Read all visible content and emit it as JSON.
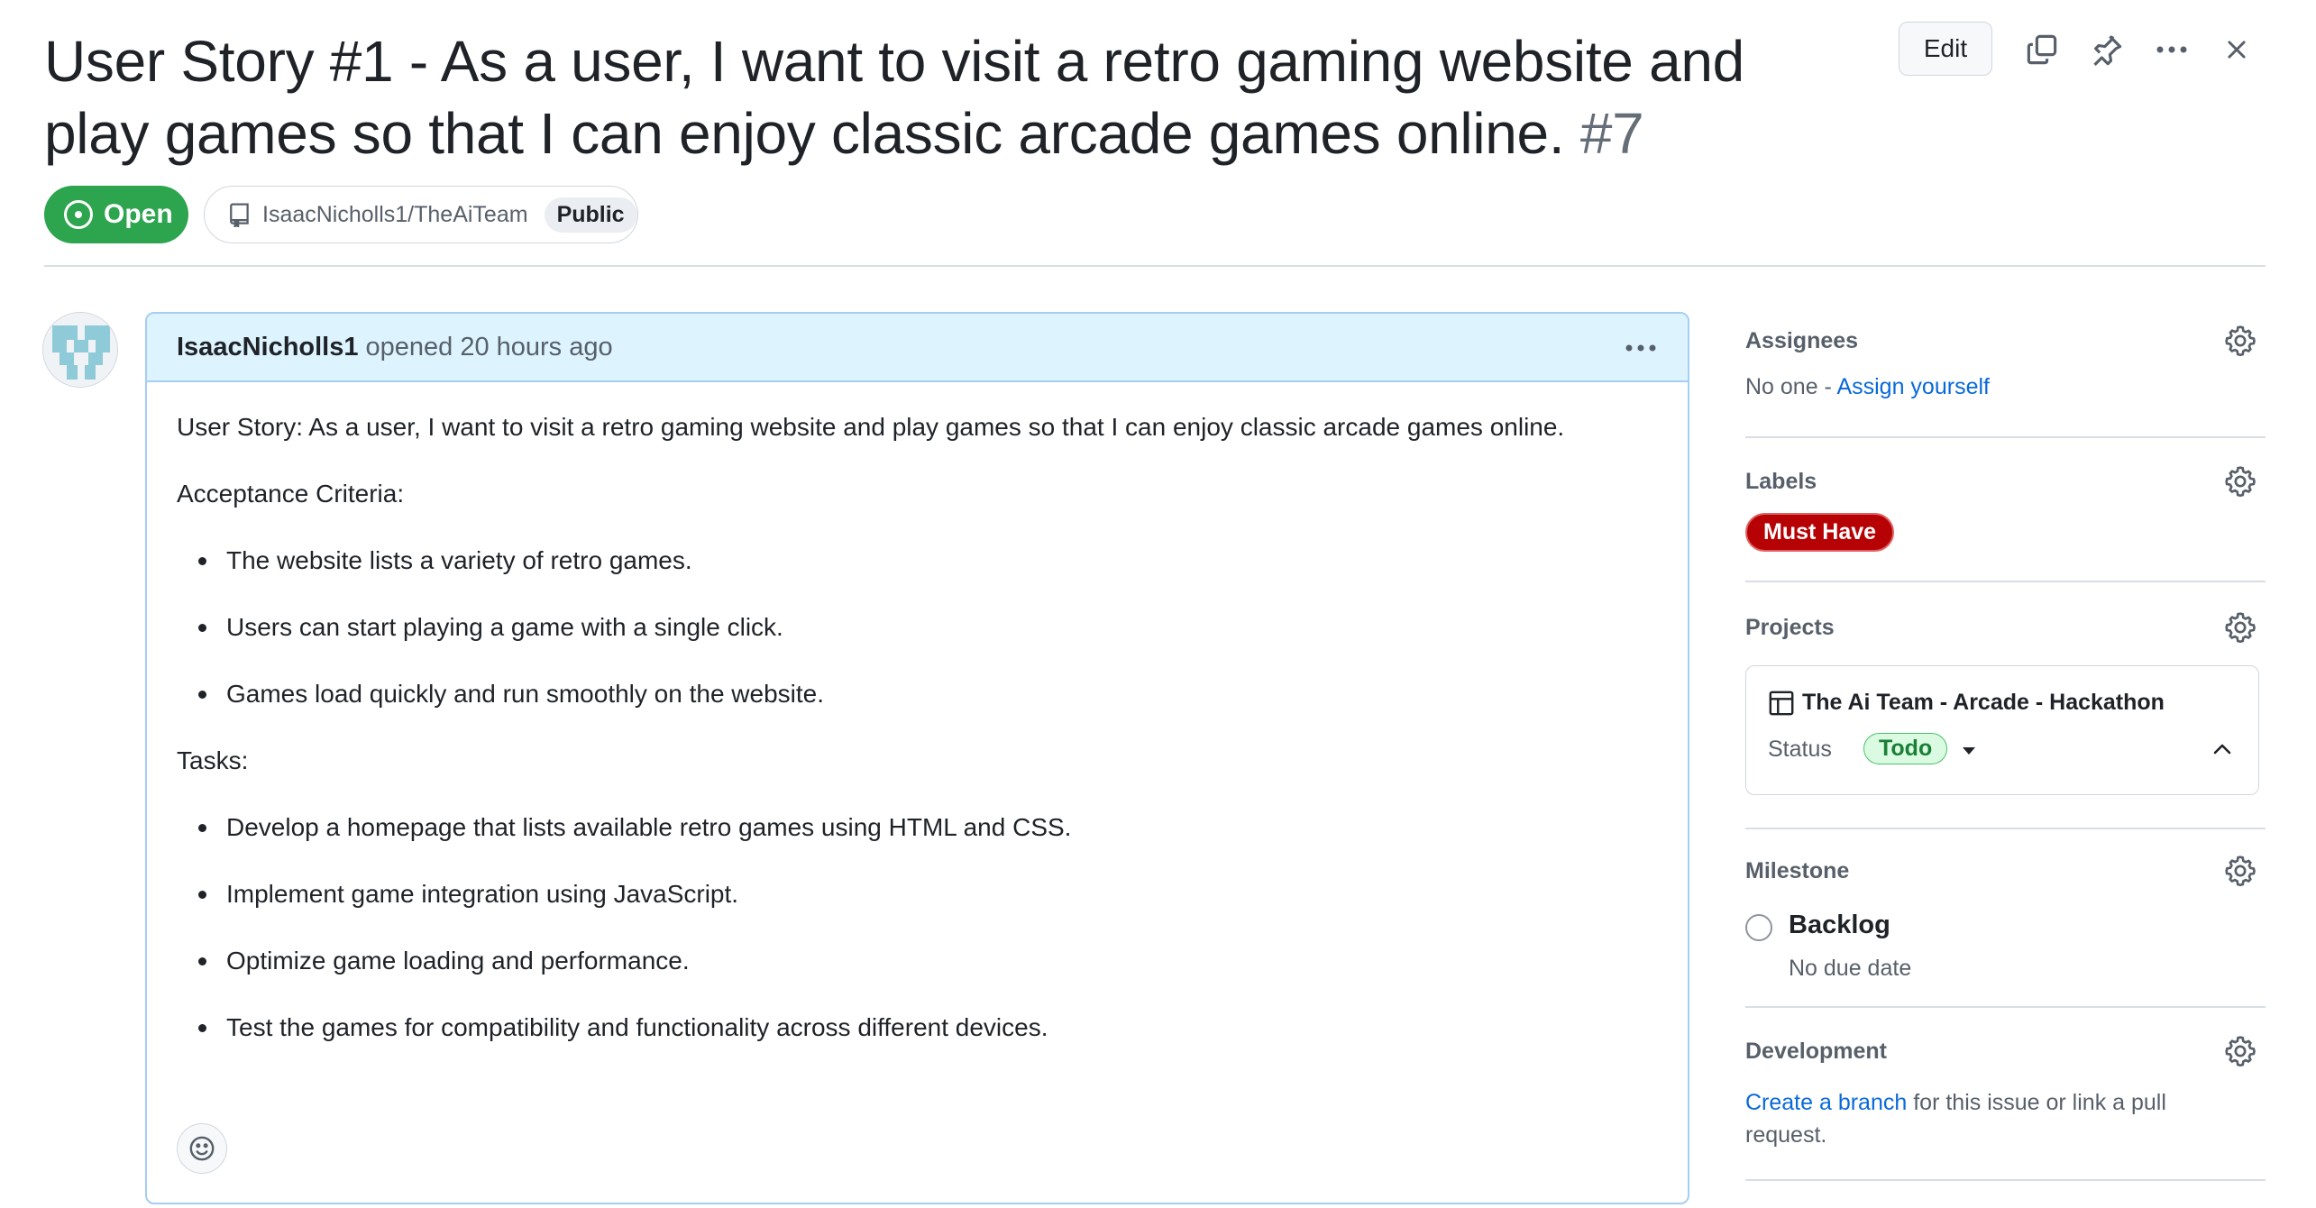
{
  "issue": {
    "title": "User Story #1 - As a user, I want to visit a retro gaming website and play games so that I can enjoy classic arcade games online.",
    "number": "#7",
    "state": "Open",
    "repo": "IsaacNicholls1/TheAiTeam",
    "visibility": "Public"
  },
  "toolbar": {
    "edit_label": "Edit",
    "icons": [
      "copy-icon",
      "pin-icon",
      "more-icon",
      "close-icon"
    ]
  },
  "comment": {
    "author": "IsaacNicholls1",
    "meta": "opened 20 hours ago",
    "intro": "User Story: As a user, I want to visit a retro gaming website and play games so that I can enjoy classic arcade games online.",
    "criteria_heading": "Acceptance Criteria:",
    "criteria": [
      "The website lists a variety of retro games.",
      "Users can start playing a game with a single click.",
      "Games load quickly and run smoothly on the website."
    ],
    "tasks_heading": "Tasks:",
    "tasks": [
      "Develop a homepage that lists available retro games using HTML and CSS.",
      "Implement game integration using JavaScript.",
      "Optimize game loading and performance.",
      "Test the games for compatibility and functionality across different devices."
    ]
  },
  "sidebar": {
    "assignees": {
      "title": "Assignees",
      "none": "No one - ",
      "assign_link": "Assign yourself"
    },
    "labels": {
      "title": "Labels",
      "items": [
        "Must Have"
      ],
      "color": "#b60205"
    },
    "projects": {
      "title": "Projects",
      "name": "The Ai Team - Arcade - Hackathon",
      "status_label": "Status",
      "status": "Todo"
    },
    "milestone": {
      "title": "Milestone",
      "name": "Backlog",
      "due": "No due date"
    },
    "development": {
      "title": "Development",
      "link": "Create a branch",
      "text": " for this issue or link a pull request."
    }
  },
  "colors": {
    "open_green": "#2da44e",
    "link_blue": "#0969da",
    "comment_header": "#ddf4ff"
  }
}
